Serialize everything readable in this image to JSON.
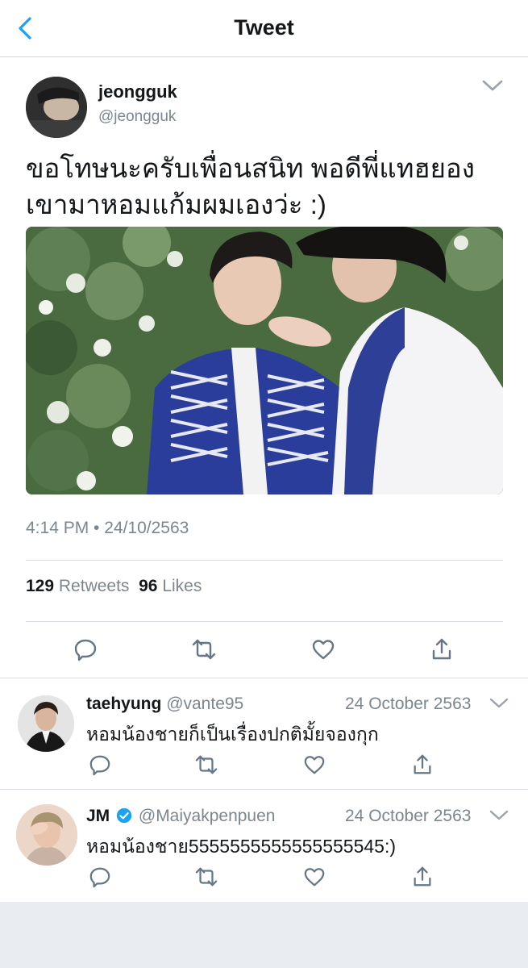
{
  "header": {
    "title": "Tweet"
  },
  "tweet": {
    "name": "jeongguk",
    "handle": "@jeongguk",
    "text_line1": "ขอโทษนะครับเพื่อนสนิท พอดีพี่แทฮยอง",
    "text_line2": "เขามาหอมแก้มผมเองว่ะ :)",
    "timestamp": "4:14 PM • 24/10/2563",
    "retweets_count": "129",
    "retweets_label": "Retweets",
    "likes_count": "96",
    "likes_label": "Likes"
  },
  "replies": [
    {
      "name": "taehyung",
      "handle": "@vante95",
      "date": "24 October 2563",
      "text": "หอมน้องชายก็เป็นเรื่องปกติมั้ยจองกุก",
      "verified": false
    },
    {
      "name": "JM",
      "handle": "@Maiyakpenpuen",
      "date": "24 October 2563",
      "text": "หอมน้องชาย5555555555555555545:)",
      "verified": true
    }
  ],
  "icons": {
    "back": "chevron-left-icon",
    "menu": "chevron-down-icon",
    "reply": "reply-icon",
    "retweet": "retweet-icon",
    "like": "heart-icon",
    "share": "share-icon",
    "verified": "verified-badge-icon"
  },
  "colors": {
    "accent": "#1da1f2",
    "icon_gray": "#657786",
    "text_gray": "#7b868f"
  }
}
